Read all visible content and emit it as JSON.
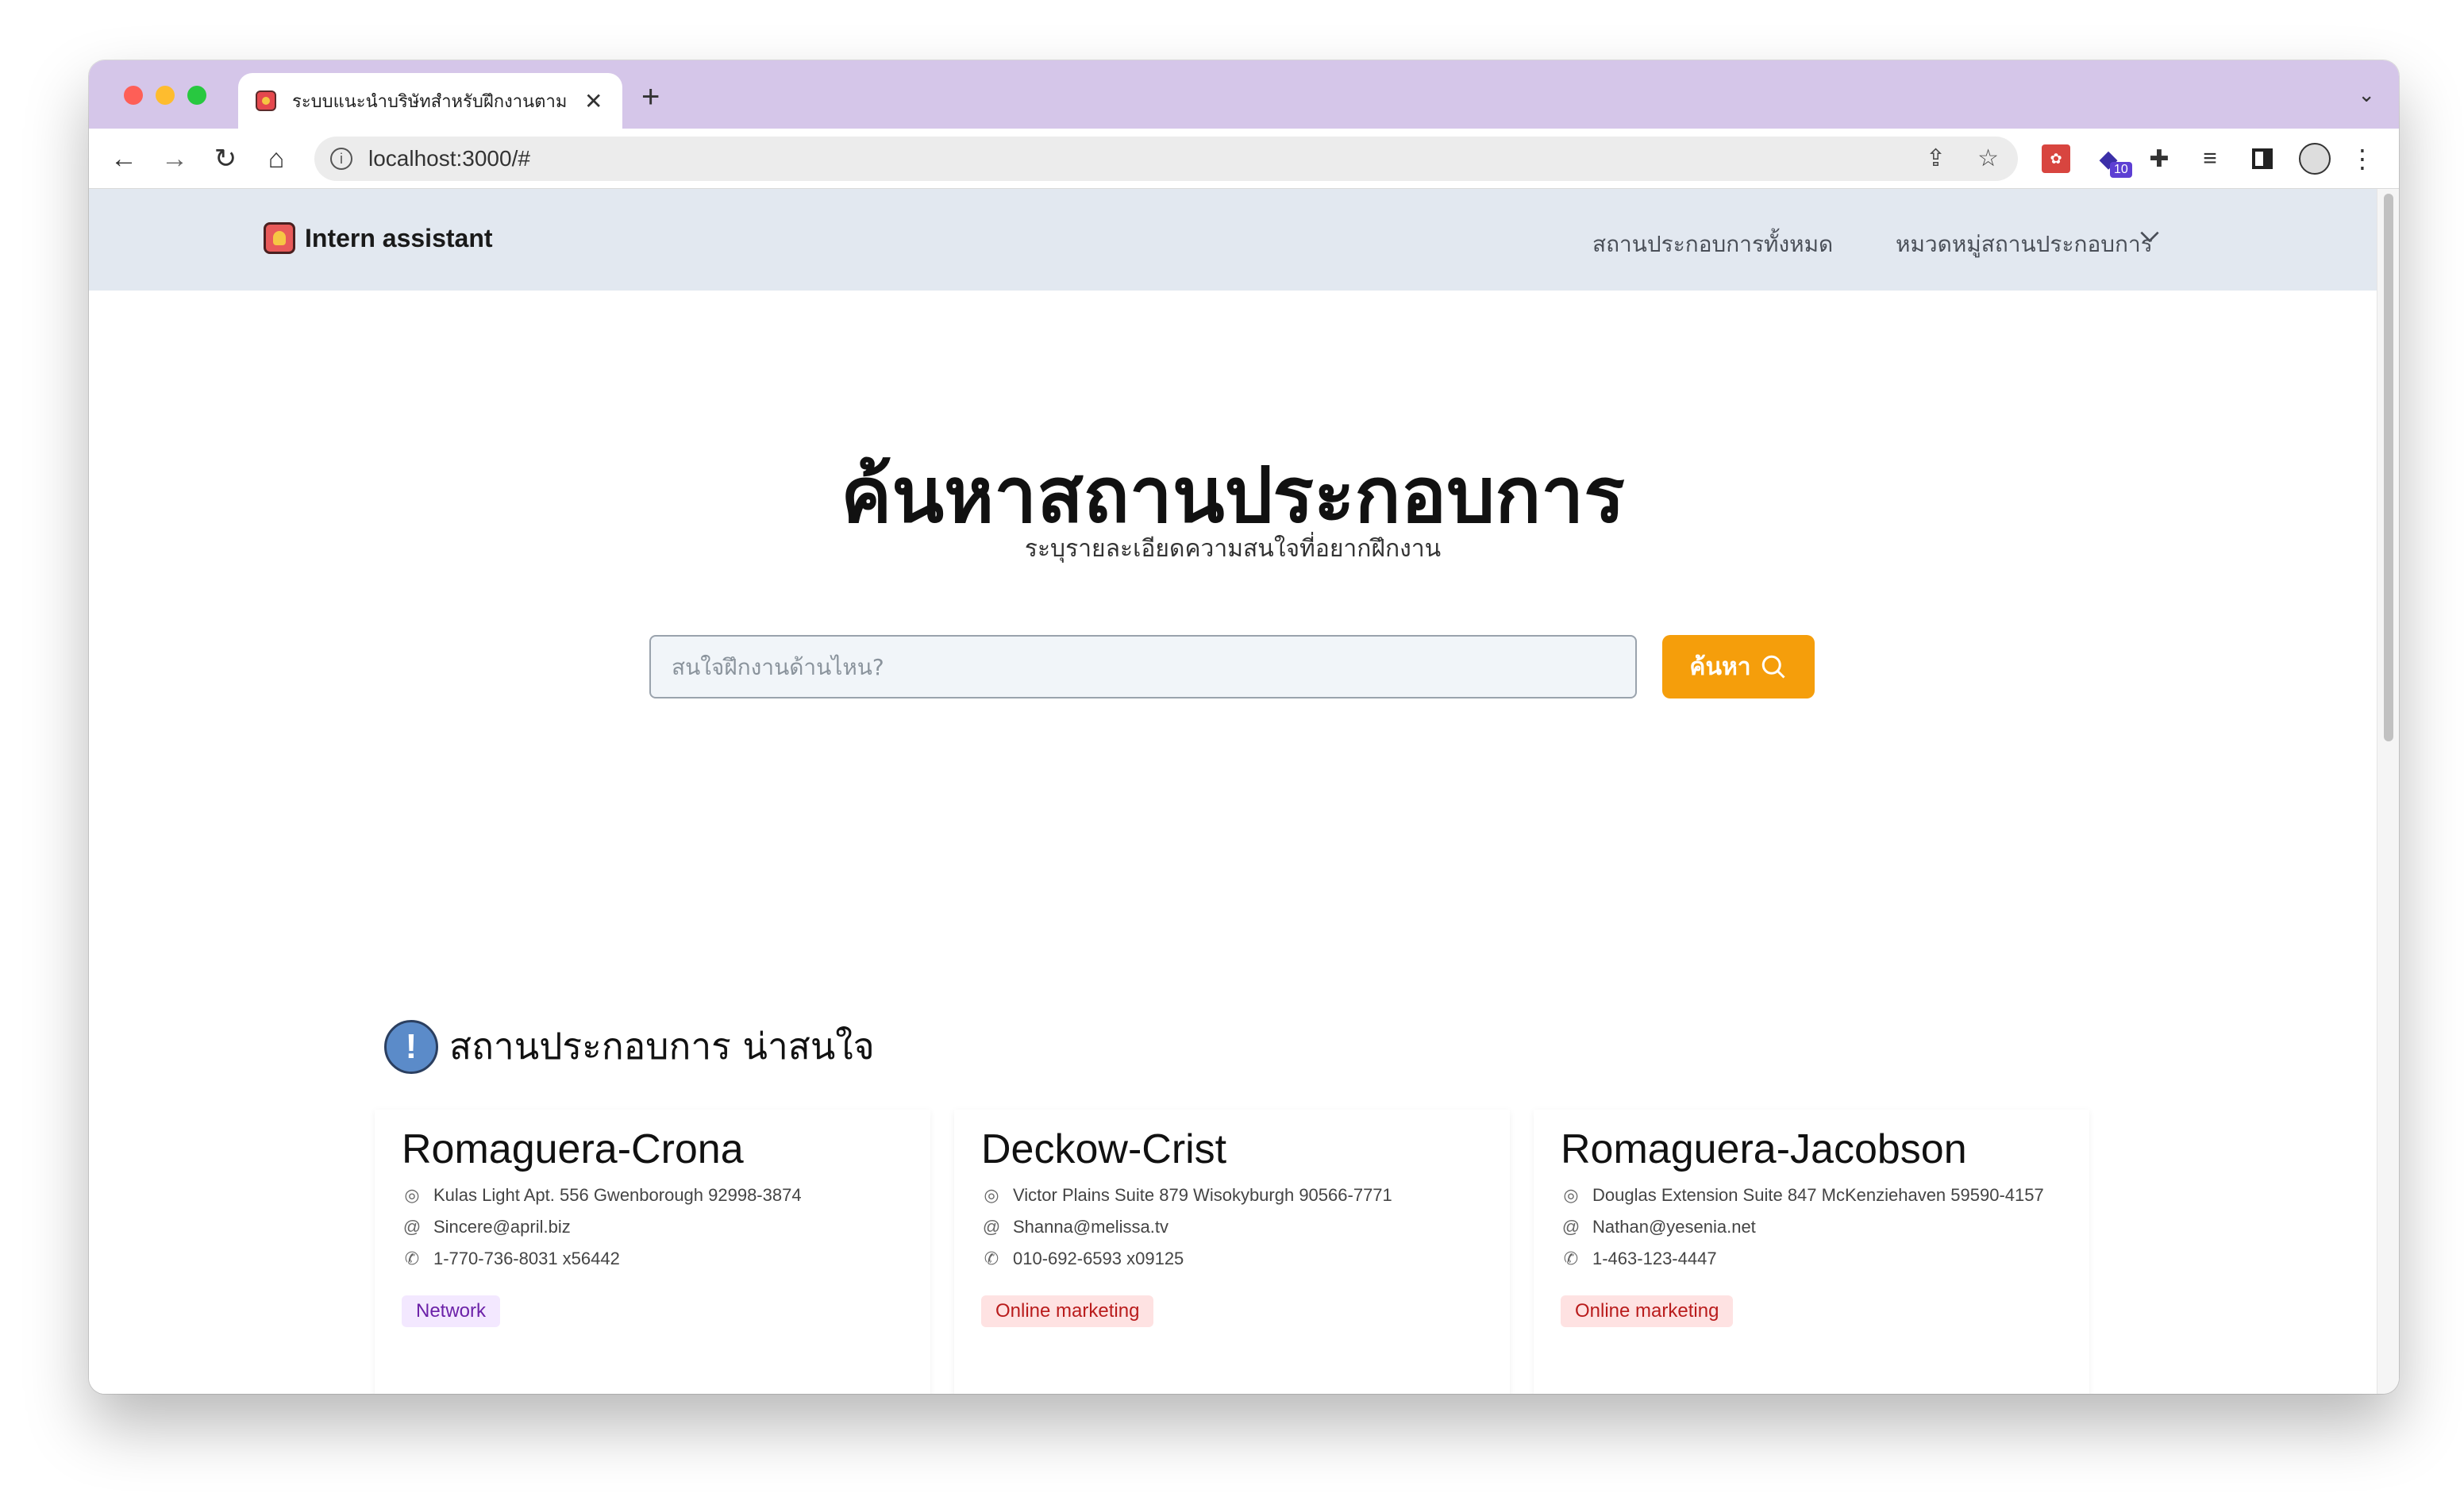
{
  "browser": {
    "tab_title": "ระบบแนะนำบริษัทสำหรับฝึกงานตาม",
    "url": "localhost:3000/#",
    "ext_badge": "10"
  },
  "site": {
    "brand": "Intern assistant",
    "nav": {
      "all_label": "สถานประกอบการทั้งหมด",
      "categories_label": "หมวดหมู่สถานประกอบการ"
    },
    "hero": {
      "title": "ค้นหาสถานประกอบการ",
      "subtitle": "ระบุรายละเอียดความสนใจที่อยากฝึกงาน",
      "search_placeholder": "สนใจฝึกงานด้านไหน?",
      "search_value": "",
      "search_button": "ค้นหา"
    },
    "section_title": "สถานประกอบการ น่าสนใจ",
    "companies": [
      {
        "name": "Romaguera-Crona",
        "address": "Kulas Light Apt. 556 Gwenborough 92998-3874",
        "email": "Sincere@april.biz",
        "phone": "1-770-736-8031 x56442",
        "tag": "Network"
      },
      {
        "name": "Deckow-Crist",
        "address": "Victor Plains Suite 879 Wisokyburgh 90566-7771",
        "email": "Shanna@melissa.tv",
        "phone": "010-692-6593 x09125",
        "tag": "Online marketing"
      },
      {
        "name": "Romaguera-Jacobson",
        "address": "Douglas Extension Suite 847 McKenziehaven 59590-4157",
        "email": "Nathan@yesenia.net",
        "phone": "1-463-123-4447",
        "tag": "Online marketing"
      }
    ]
  },
  "colors": {
    "tabbar": "#d5c6e9",
    "nav_bg": "#e2e8f0",
    "accent": "#f59e0b",
    "tag_network_bg": "#f3e8ff",
    "tag_marketing_bg": "#fee2e2"
  },
  "icons": [
    "favicon-icon",
    "close-icon",
    "plus-icon",
    "chevron-down-icon",
    "back-icon",
    "forward-icon",
    "reload-icon",
    "home-icon",
    "info-icon",
    "share-icon",
    "star-icon",
    "puzzle-icon",
    "reading-list-icon",
    "side-panel-icon",
    "avatar",
    "more-icon",
    "search-icon",
    "warning-icon",
    "location-icon",
    "email-icon",
    "phone-icon"
  ]
}
